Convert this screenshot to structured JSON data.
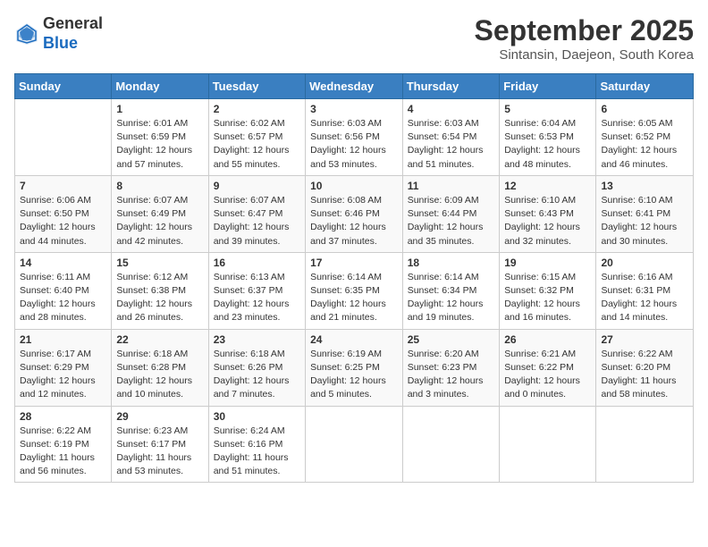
{
  "header": {
    "logo_general": "General",
    "logo_blue": "Blue",
    "month_title": "September 2025",
    "location": "Sintansin, Daejeon, South Korea"
  },
  "days_of_week": [
    "Sunday",
    "Monday",
    "Tuesday",
    "Wednesday",
    "Thursday",
    "Friday",
    "Saturday"
  ],
  "weeks": [
    [
      {
        "day": "",
        "info": ""
      },
      {
        "day": "1",
        "info": "Sunrise: 6:01 AM\nSunset: 6:59 PM\nDaylight: 12 hours\nand 57 minutes."
      },
      {
        "day": "2",
        "info": "Sunrise: 6:02 AM\nSunset: 6:57 PM\nDaylight: 12 hours\nand 55 minutes."
      },
      {
        "day": "3",
        "info": "Sunrise: 6:03 AM\nSunset: 6:56 PM\nDaylight: 12 hours\nand 53 minutes."
      },
      {
        "day": "4",
        "info": "Sunrise: 6:03 AM\nSunset: 6:54 PM\nDaylight: 12 hours\nand 51 minutes."
      },
      {
        "day": "5",
        "info": "Sunrise: 6:04 AM\nSunset: 6:53 PM\nDaylight: 12 hours\nand 48 minutes."
      },
      {
        "day": "6",
        "info": "Sunrise: 6:05 AM\nSunset: 6:52 PM\nDaylight: 12 hours\nand 46 minutes."
      }
    ],
    [
      {
        "day": "7",
        "info": "Sunrise: 6:06 AM\nSunset: 6:50 PM\nDaylight: 12 hours\nand 44 minutes."
      },
      {
        "day": "8",
        "info": "Sunrise: 6:07 AM\nSunset: 6:49 PM\nDaylight: 12 hours\nand 42 minutes."
      },
      {
        "day": "9",
        "info": "Sunrise: 6:07 AM\nSunset: 6:47 PM\nDaylight: 12 hours\nand 39 minutes."
      },
      {
        "day": "10",
        "info": "Sunrise: 6:08 AM\nSunset: 6:46 PM\nDaylight: 12 hours\nand 37 minutes."
      },
      {
        "day": "11",
        "info": "Sunrise: 6:09 AM\nSunset: 6:44 PM\nDaylight: 12 hours\nand 35 minutes."
      },
      {
        "day": "12",
        "info": "Sunrise: 6:10 AM\nSunset: 6:43 PM\nDaylight: 12 hours\nand 32 minutes."
      },
      {
        "day": "13",
        "info": "Sunrise: 6:10 AM\nSunset: 6:41 PM\nDaylight: 12 hours\nand 30 minutes."
      }
    ],
    [
      {
        "day": "14",
        "info": "Sunrise: 6:11 AM\nSunset: 6:40 PM\nDaylight: 12 hours\nand 28 minutes."
      },
      {
        "day": "15",
        "info": "Sunrise: 6:12 AM\nSunset: 6:38 PM\nDaylight: 12 hours\nand 26 minutes."
      },
      {
        "day": "16",
        "info": "Sunrise: 6:13 AM\nSunset: 6:37 PM\nDaylight: 12 hours\nand 23 minutes."
      },
      {
        "day": "17",
        "info": "Sunrise: 6:14 AM\nSunset: 6:35 PM\nDaylight: 12 hours\nand 21 minutes."
      },
      {
        "day": "18",
        "info": "Sunrise: 6:14 AM\nSunset: 6:34 PM\nDaylight: 12 hours\nand 19 minutes."
      },
      {
        "day": "19",
        "info": "Sunrise: 6:15 AM\nSunset: 6:32 PM\nDaylight: 12 hours\nand 16 minutes."
      },
      {
        "day": "20",
        "info": "Sunrise: 6:16 AM\nSunset: 6:31 PM\nDaylight: 12 hours\nand 14 minutes."
      }
    ],
    [
      {
        "day": "21",
        "info": "Sunrise: 6:17 AM\nSunset: 6:29 PM\nDaylight: 12 hours\nand 12 minutes."
      },
      {
        "day": "22",
        "info": "Sunrise: 6:18 AM\nSunset: 6:28 PM\nDaylight: 12 hours\nand 10 minutes."
      },
      {
        "day": "23",
        "info": "Sunrise: 6:18 AM\nSunset: 6:26 PM\nDaylight: 12 hours\nand 7 minutes."
      },
      {
        "day": "24",
        "info": "Sunrise: 6:19 AM\nSunset: 6:25 PM\nDaylight: 12 hours\nand 5 minutes."
      },
      {
        "day": "25",
        "info": "Sunrise: 6:20 AM\nSunset: 6:23 PM\nDaylight: 12 hours\nand 3 minutes."
      },
      {
        "day": "26",
        "info": "Sunrise: 6:21 AM\nSunset: 6:22 PM\nDaylight: 12 hours\nand 0 minutes."
      },
      {
        "day": "27",
        "info": "Sunrise: 6:22 AM\nSunset: 6:20 PM\nDaylight: 11 hours\nand 58 minutes."
      }
    ],
    [
      {
        "day": "28",
        "info": "Sunrise: 6:22 AM\nSunset: 6:19 PM\nDaylight: 11 hours\nand 56 minutes."
      },
      {
        "day": "29",
        "info": "Sunrise: 6:23 AM\nSunset: 6:17 PM\nDaylight: 11 hours\nand 53 minutes."
      },
      {
        "day": "30",
        "info": "Sunrise: 6:24 AM\nSunset: 6:16 PM\nDaylight: 11 hours\nand 51 minutes."
      },
      {
        "day": "",
        "info": ""
      },
      {
        "day": "",
        "info": ""
      },
      {
        "day": "",
        "info": ""
      },
      {
        "day": "",
        "info": ""
      }
    ]
  ]
}
